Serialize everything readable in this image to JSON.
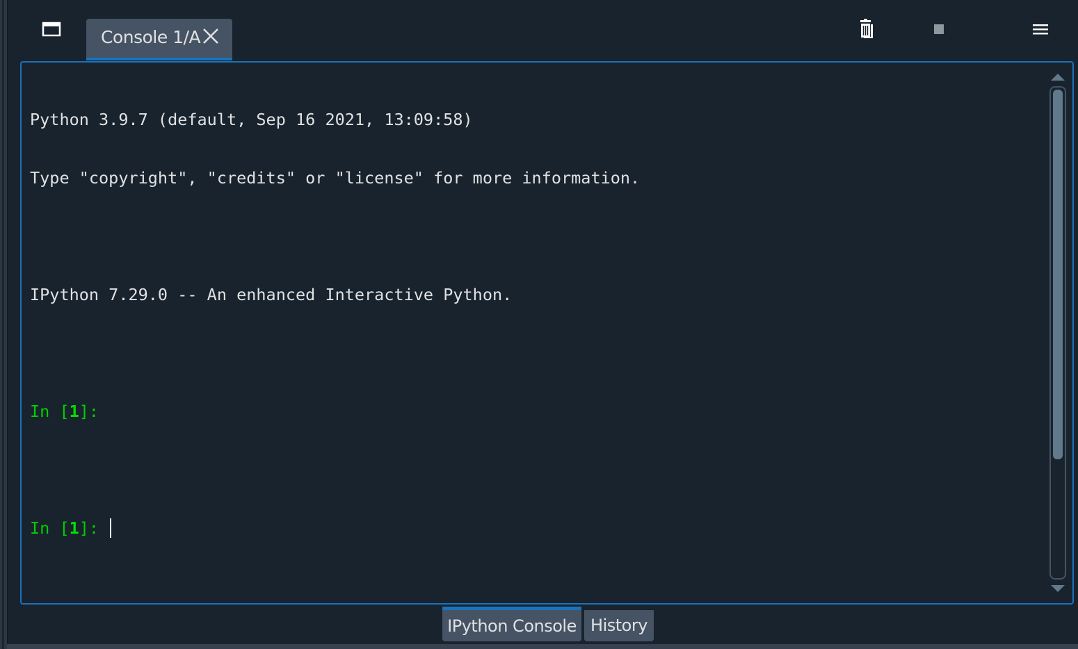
{
  "toolbar": {
    "undock_icon": "undock-window-icon",
    "clear_icon": "trash-icon",
    "stop_icon": "stop-icon",
    "menu_icon": "hamburger-menu-icon"
  },
  "tabs": [
    {
      "label": "Console 1/A",
      "active": true
    }
  ],
  "console": {
    "lines": [
      "Python 3.9.7 (default, Sep 16 2021, 13:09:58)",
      "Type \"copyright\", \"credits\" or \"license\" for more information.",
      "",
      "IPython 7.29.0 -- An enhanced Interactive Python.",
      ""
    ],
    "prompt1": {
      "prefix": "In [",
      "number": "1",
      "suffix": "]: "
    },
    "prompt2": {
      "prefix": "In [",
      "number": "1",
      "suffix": "]: "
    }
  },
  "dock_tabs": [
    {
      "label": "IPython Console",
      "active": true
    },
    {
      "label": "History",
      "active": false
    }
  ],
  "colors": {
    "background": "#19232d",
    "accent": "#1a72bb",
    "tab_bg": "#455364",
    "text": "#e0e1e3",
    "prompt": "#00d000"
  }
}
